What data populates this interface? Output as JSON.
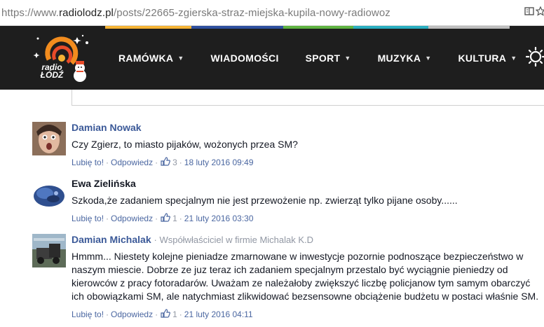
{
  "browser": {
    "url_prefix": "https://www.",
    "url_host": "radiolodz.pl",
    "url_path": "/posts/22665-zgierska-straz-miejska-kupila-nowy-radiowoz"
  },
  "header": {
    "logo_text": "radio ŁÓDŹ",
    "nav": [
      "RAMÓWKA",
      "WIADOMOŚCI",
      "SPORT",
      "MUZYKA",
      "KULTURA"
    ],
    "strip_colors": [
      "#f5b335",
      "#2e4f9e",
      "#5fb341",
      "#2aaec0",
      "#bdbdbd"
    ]
  },
  "comments": [
    {
      "author": "Damian Nowak",
      "affiliation": "",
      "text": "Czy Zgierz, to miasto pijaków, wożonych przea SM?",
      "like": "Lubię to!",
      "reply": "Odpowiedz",
      "likes": "3",
      "date": "18 luty 2016 09:49"
    },
    {
      "author": "Ewa Zielińska",
      "affiliation": "",
      "text": "Szkoda,że zadaniem specjalnym nie jest przewożenie np. zwierząt tylko pijane osoby......",
      "like": "Lubię to!",
      "reply": "Odpowiedz",
      "likes": "1",
      "date": "21 luty 2016 03:30"
    },
    {
      "author": "Damian Michalak",
      "affiliation": "· Współwłaściciel w firmie Michalak K.D",
      "text": "Hmmm... Niestety kolejne pieniadze zmarnowane w inwestycje pozornie podnoszące bezpieczeństwo w naszym miescie. Dobrze ze juz teraz ich zadaniem specjalnym przestalo być wyciągnie pieniedzy od kierowców z pracy fotoradarów. Uważam ze należałoby zwiększyć liczbę policjanow tym samym obarczyć ich obowiązkami SM, ale natychmiast zlikwidować bezsensowne obciążenie budżetu w postaci właśnie SM.",
      "like": "Lubię to!",
      "reply": "Odpowiedz",
      "likes": "1",
      "date": "21 luty 2016 04:11"
    }
  ]
}
